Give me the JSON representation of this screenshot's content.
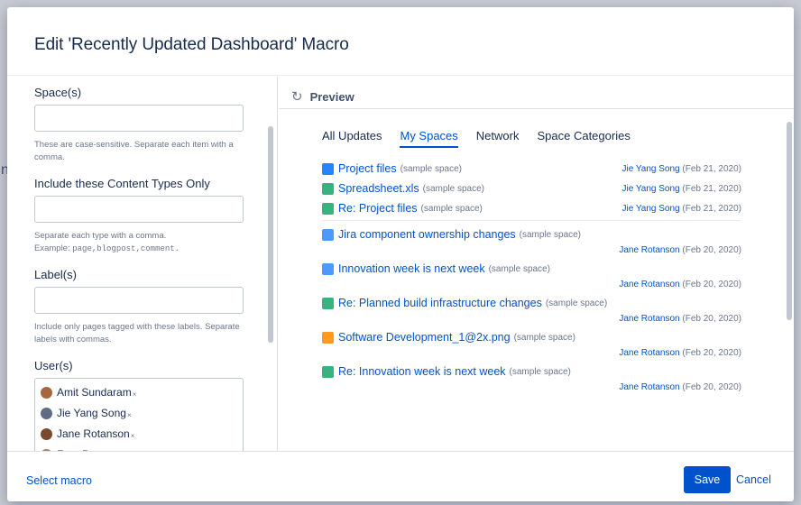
{
  "background": {
    "edge_text": "nt"
  },
  "dialog": {
    "title": "Edit 'Recently Updated Dashboard' Macro"
  },
  "left": {
    "space": {
      "label": "Space(s)",
      "value": "",
      "help": "These are case-sensitive. Separate each item with a comma."
    },
    "types": {
      "label": "Include these Content Types Only",
      "value": "",
      "help_line1": "Separate each type with a comma.",
      "help_prefix": "Example: ",
      "help_code": "page,blogpost,comment."
    },
    "labels": {
      "label": "Label(s)",
      "value": "",
      "help": "Include only pages tagged with these labels. Separate labels with commas."
    },
    "users": {
      "label": "User(s)",
      "items": [
        {
          "name": "Amit Sundaram",
          "color": "#a5673f"
        },
        {
          "name": "Jie Yang Song",
          "color": "#5e6c84"
        },
        {
          "name": "Jane Rotanson",
          "color": "#7a4a2e"
        },
        {
          "name": "Fran Perez",
          "color": "#c27b4a"
        }
      ],
      "remove_glyph": "×"
    }
  },
  "preview": {
    "title": "Preview",
    "refresh_icon": "↻",
    "tabs": [
      "All Updates",
      "My Spaces",
      "Network",
      "Space Categories"
    ],
    "active_tab": 1,
    "updates": [
      {
        "title": "Project files",
        "space": "(sample space)",
        "who": "Jie Yang Song",
        "when": "(Feb 21, 2020)",
        "icon": "page-icon",
        "icon_color": "#2684ff",
        "wrap": false
      },
      {
        "title": "Spreadsheet.xls",
        "space": "(sample space)",
        "who": "Jie Yang Song",
        "when": "(Feb 21, 2020)",
        "icon": "spreadsheet-icon",
        "icon_color": "#36b37e",
        "wrap": false
      },
      {
        "title": "Re: Project files",
        "space": "(sample space)",
        "who": "Jie Yang Song",
        "when": "(Feb 21, 2020)",
        "icon": "comment-icon",
        "icon_color": "#36b37e",
        "wrap": false
      },
      {
        "title": "Jira component ownership changes",
        "space": "(sample space)",
        "who": "Jane Rotanson",
        "when": "(Feb 20, 2020)",
        "icon": "blog-icon",
        "icon_color": "#4c9aff",
        "wrap": true
      },
      {
        "title": "Innovation week is next week",
        "space": "(sample space)",
        "who": "Jane Rotanson",
        "when": "(Feb 20, 2020)",
        "icon": "blog-icon",
        "icon_color": "#4c9aff",
        "wrap": true
      },
      {
        "title": "Re: Planned build infrastructure changes",
        "space": "(sample space)",
        "who": "Jane Rotanson",
        "when": "(Feb 20, 2020)",
        "icon": "comment-icon",
        "icon_color": "#36b37e",
        "wrap": true
      },
      {
        "title": "Software Development_1@2x.png",
        "space": "(sample space)",
        "who": "Jane Rotanson",
        "when": "(Feb 20, 2020)",
        "icon": "image-icon",
        "icon_color": "#ff991f",
        "wrap": true
      },
      {
        "title": "Re: Innovation week is next week",
        "space": "(sample space)",
        "who": "Jane Rotanson",
        "when": "(Feb 20, 2020)",
        "icon": "comment-icon",
        "icon_color": "#36b37e",
        "wrap": true
      }
    ]
  },
  "footer": {
    "select_macro": "Select macro",
    "save": "Save",
    "cancel": "Cancel"
  }
}
